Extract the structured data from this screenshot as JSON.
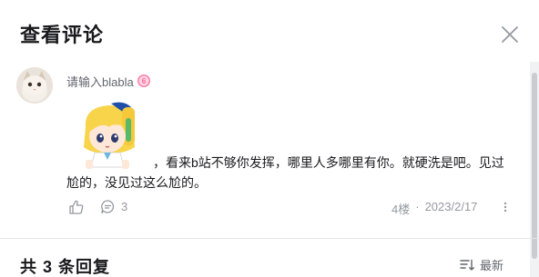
{
  "header": {
    "title": "查看评论"
  },
  "comment": {
    "username": "请输入blabla",
    "text_line1": "，看来b站不够你发挥，哪里人多哪里有你。就硬洗是吧。见过",
    "text_line2": "尬的，没见过这么尬的。",
    "reply_count": "3",
    "floor": "4楼",
    "separator": "·",
    "date": "2023/2/17"
  },
  "replies": {
    "header": "共 3 条回复",
    "sort_label": "最新"
  },
  "colors": {
    "text_primary": "#18191c",
    "text_secondary": "#9499a0",
    "divider": "#e3e5e7",
    "badge": "#ff6699"
  },
  "icons": [
    "close-icon",
    "level-badge-icon",
    "like-icon",
    "reply-icon",
    "more-icon",
    "sort-icon"
  ]
}
